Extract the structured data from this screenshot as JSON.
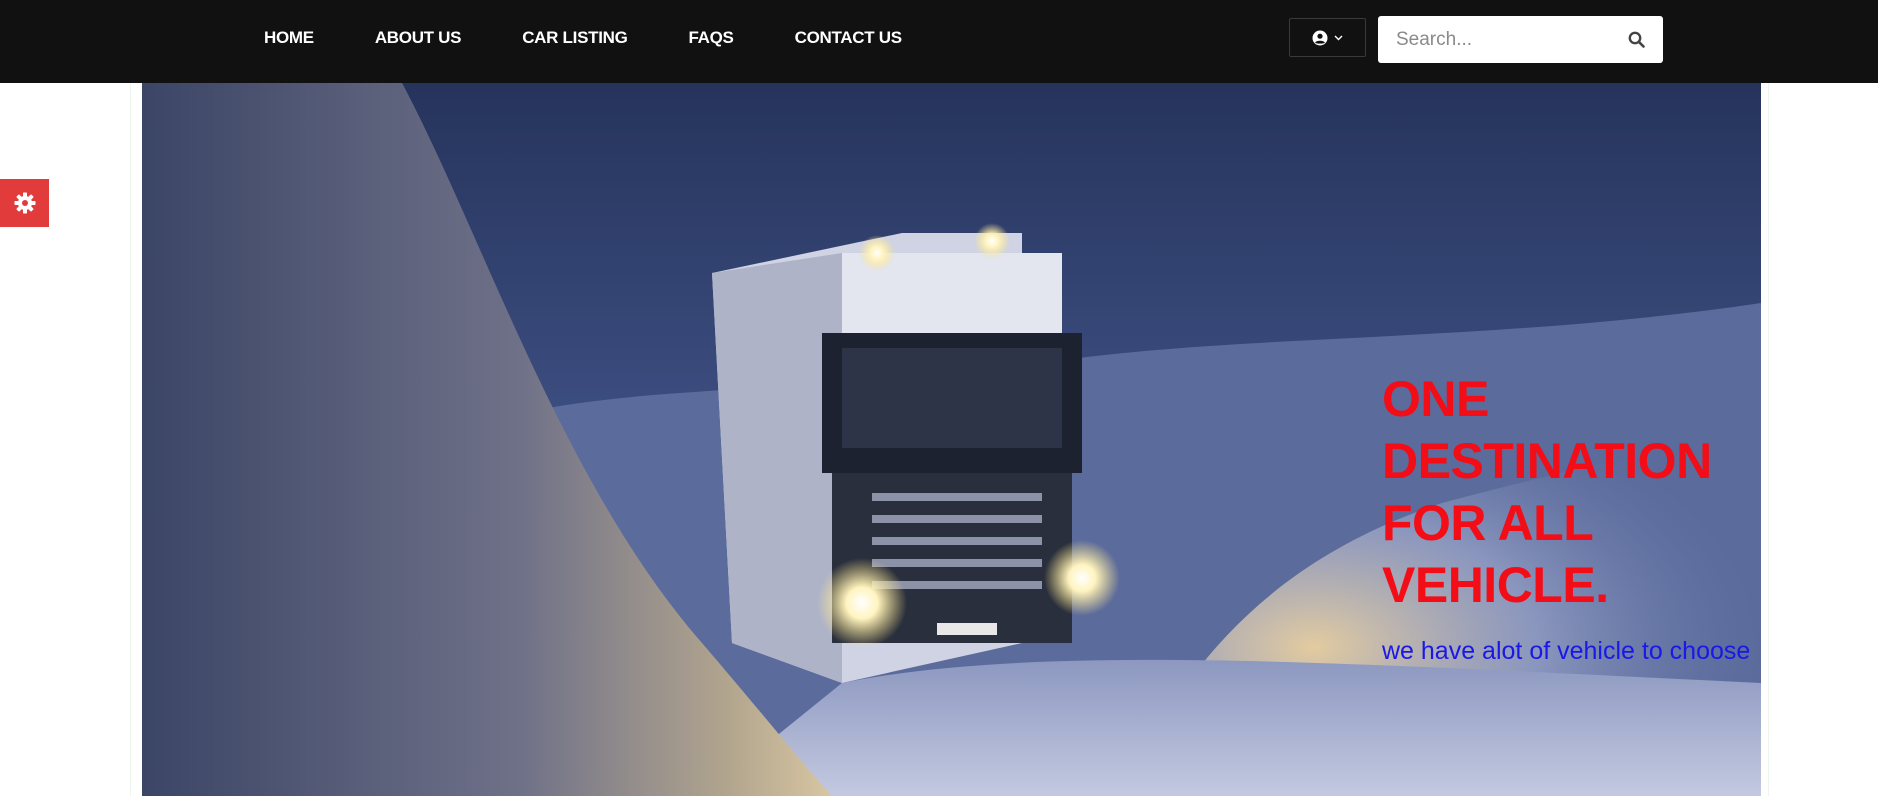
{
  "nav": {
    "items": [
      {
        "label": "HOME"
      },
      {
        "label": "ABOUT US"
      },
      {
        "label": "CAR LISTING"
      },
      {
        "label": "FAQS"
      },
      {
        "label": "CONTACT US"
      }
    ]
  },
  "user_menu": {
    "icon": "user-circle-icon",
    "caret_icon": "chevron-down-icon"
  },
  "search": {
    "placeholder": "Search...",
    "value": "",
    "icon": "search-icon"
  },
  "settings_tab": {
    "icon": "gear-icon",
    "color": "#e23b3b"
  },
  "hero": {
    "headline_lines": [
      "ONE",
      "DESTINATION",
      "FOR ALL",
      "VEHICLE."
    ],
    "subline": "we have alot of vehicle to choose",
    "headline_color": "#f20d17",
    "subline_color": "#1a18e6"
  },
  "colors": {
    "nav_bg": "#111111",
    "nav_text": "#ffffff"
  }
}
